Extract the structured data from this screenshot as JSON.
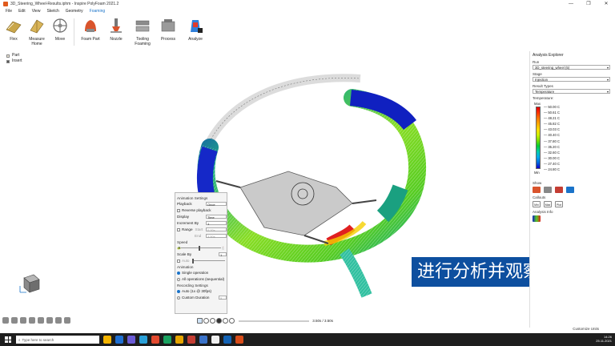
{
  "window": {
    "title": "3D_Steering_Wheel-Results.iphm - Inspire PolyFoam 2021.2",
    "controls": [
      "—",
      "❐",
      "✕"
    ]
  },
  "menu": [
    {
      "label": "File",
      "active": false
    },
    {
      "label": "Edit",
      "active": false
    },
    {
      "label": "View",
      "active": false
    },
    {
      "label": "Sketch",
      "active": false
    },
    {
      "label": "Geometry",
      "active": false
    },
    {
      "label": "Foaming",
      "active": true
    }
  ],
  "ribbon": {
    "flex": "Flex",
    "measure": "Measure Home",
    "move": "Move",
    "foam_part": "Foam Part",
    "nozzle": "Nozzle",
    "tooling": "Tooling Foaming",
    "process": "Process",
    "analyze": "Analyze"
  },
  "tree": {
    "part": "Part",
    "insert": "Insert"
  },
  "animation_settings": {
    "title": "Animation Settings",
    "playback_label": "Playback",
    "playback_value": "Once",
    "reverse_label": "Reverse playback",
    "display_label": "Display",
    "display_value": "Time",
    "increment_label": "Increment By",
    "increment_value": "1",
    "range_label": "Range",
    "start_label": "Start",
    "start_value": "0.00s",
    "end_label": "End",
    "end_value": "3.50s",
    "speed_label": "Speed",
    "scale_label": "Scale By",
    "scale_value": "1",
    "auto_label": "Auto",
    "animation_label": "Animation",
    "single_label": "Single operation",
    "all_label": "All operations (sequential)",
    "recording_label": "Recording Settings",
    "auto_fps_label": "Auto (1x @ 30fps)",
    "custom_label": "Custom Duration",
    "custom_value": "5"
  },
  "playback": {
    "time": "3.50s / 3.50s"
  },
  "caption": "进行分析并观察结果",
  "explorer": {
    "title": "Analysis Explorer",
    "run_label": "Run",
    "run_value": "3D_steering_wheel (5)",
    "stage_label": "Stage",
    "stage_value": "Injection",
    "result_label": "Result Types",
    "result_value": "Temperature",
    "legend_title": "Temperature:",
    "max_label": "Max",
    "min_label": "Min",
    "ticks": [
      "50.00 C",
      "50.61 C",
      "48.21 C",
      "45.82 C",
      "43.03 C",
      "40.40 C",
      "37.80 C",
      "35.20 C",
      "32.60 C",
      "30.00 C",
      "27.40 C",
      "24.80 C"
    ],
    "show_label": "Show",
    "callouts_label": "Callouts",
    "callout_items": [
      "Min",
      "Max",
      "Plot"
    ],
    "analysis_info_label": "Analysis Info",
    "legend_colors": [
      "#e00000",
      "#ff3300",
      "#ff7700",
      "#ffaa00",
      "#ffdd00",
      "#ccee00",
      "#77dd00",
      "#00cc33",
      "#00ccaa",
      "#00aaee",
      "#0066dd",
      "#1100cc"
    ]
  },
  "status": {
    "units": "Customize Units"
  },
  "taskbar": {
    "search": "Type here to search",
    "time": "14:26",
    "date": "25.11.2021",
    "app_colors": [
      "#f4b400",
      "#1f6fd1",
      "#6b5bd6",
      "#2aa0d8",
      "#e24a2f",
      "#1aa260",
      "#e6a500",
      "#c43d33",
      "#3b73c9",
      "#f0f0f0",
      "#1463b5",
      "#d94d1a"
    ]
  },
  "mesh": {
    "shell_color": "#9a9a9a",
    "hot": "#e02020",
    "warm": "#f5d000",
    "mid": "#55cc22",
    "cool": "#10aa88",
    "cold": "#1020c0"
  }
}
